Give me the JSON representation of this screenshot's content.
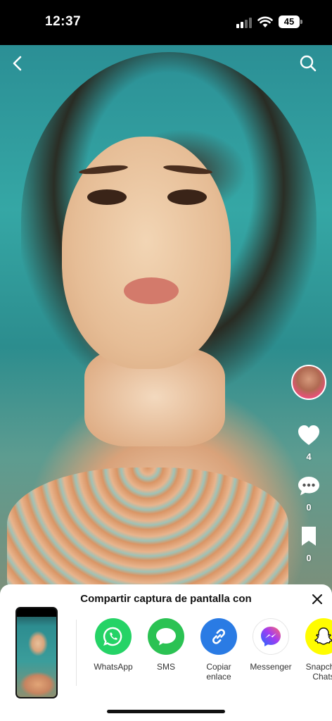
{
  "status_bar": {
    "time": "12:37",
    "battery": "45"
  },
  "video": {
    "likes": "4",
    "comments": "0",
    "saves": "0"
  },
  "share_sheet": {
    "title": "Compartir captura de pantalla con",
    "apps": [
      {
        "label": "WhatsApp",
        "icon": "whatsapp-icon",
        "color": "#25D366"
      },
      {
        "label": "SMS",
        "icon": "sms-icon",
        "color": "#2BC253"
      },
      {
        "label": "Copiar\nenlace",
        "icon": "link-icon",
        "color": "#2A7BE4"
      },
      {
        "label": "Messenger",
        "icon": "messenger-icon",
        "color": "#FFFFFF"
      },
      {
        "label": "Snapchat\nChats",
        "icon": "snapchat-icon",
        "color": "#FFFC00"
      }
    ]
  }
}
